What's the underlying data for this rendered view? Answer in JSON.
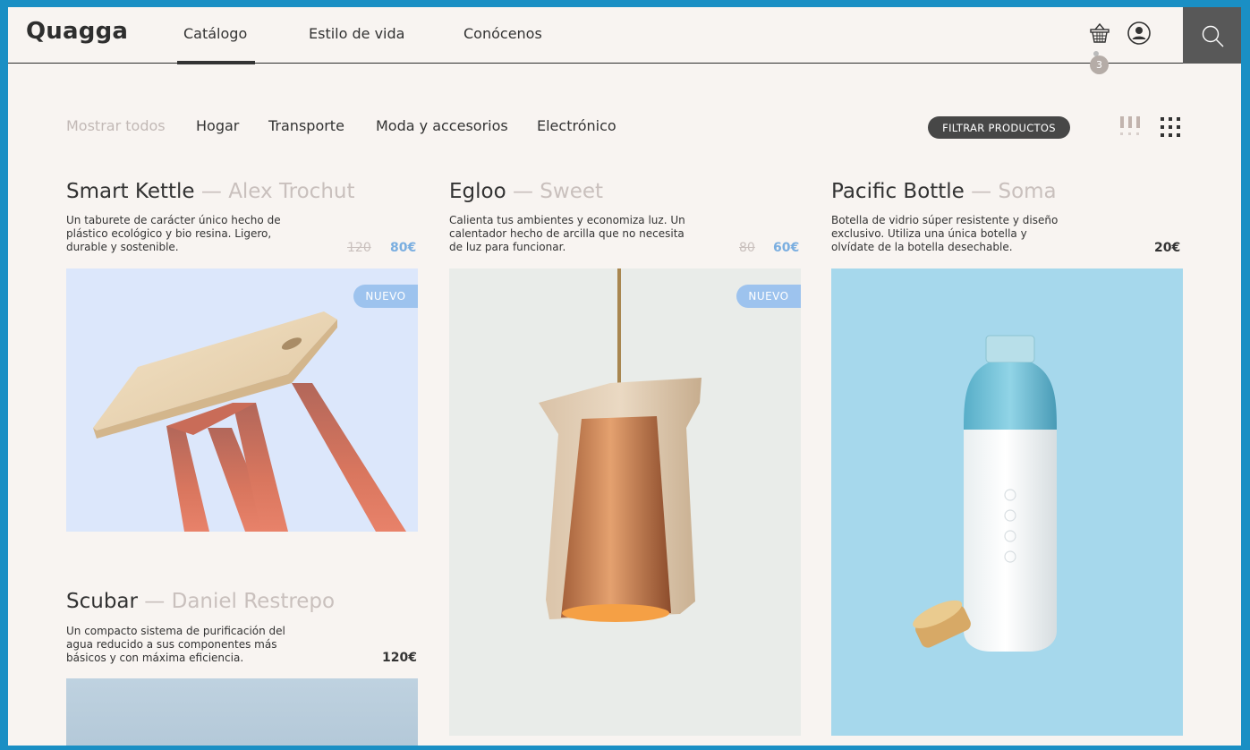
{
  "brand": "Quagga",
  "nav": {
    "items": [
      {
        "label": "Catálogo"
      },
      {
        "label": "Estilo de vida"
      },
      {
        "label": "Conócenos"
      }
    ],
    "active": "Catálogo"
  },
  "cart": {
    "count": "3"
  },
  "filters": {
    "categories": [
      {
        "label": "Mostrar todos"
      },
      {
        "label": "Hogar"
      },
      {
        "label": "Transporte"
      },
      {
        "label": "Moda y accesorios"
      },
      {
        "label": "Electrónico"
      }
    ],
    "selected": "Mostrar todos",
    "filter_button": "FILTRAR PRODUCTOS"
  },
  "products": [
    {
      "name": "Smart Kettle",
      "separator": "—",
      "author": "Alex Trochut",
      "description": "Un taburete de carácter único hecho de plástico ecológico y bio resina. Ligero, durable y sostenible.",
      "old_price": "120",
      "price": "80€",
      "badge": "NUEVO"
    },
    {
      "name": "Egloo",
      "separator": "—",
      "author": "Sweet",
      "description": "Calienta tus ambientes y economiza luz. Un calentador hecho de arcilla que no necesita de luz para funcionar.",
      "old_price": "80",
      "price": "60€",
      "badge": "NUEVO"
    },
    {
      "name": "Pacific Bottle",
      "separator": "—",
      "author": "Soma",
      "description": "Botella de vidrio súper resistente y diseño exclusivo. Utiliza una única botella y olvídate de la botella desechable.",
      "price": "20€"
    },
    {
      "name": "Scubar",
      "separator": "—",
      "author": "Daniel Restrepo",
      "description": "Un compacto sistema de purificación del agua reducido a sus componentes más básicos y con máxima eficiencia.",
      "price": "120€"
    }
  ],
  "colors": {
    "background": "#f8f4f1",
    "accent_price": "#7aaee0",
    "badge": "#9dc3ee",
    "muted": "#c9c0bd",
    "dark": "#333333"
  }
}
